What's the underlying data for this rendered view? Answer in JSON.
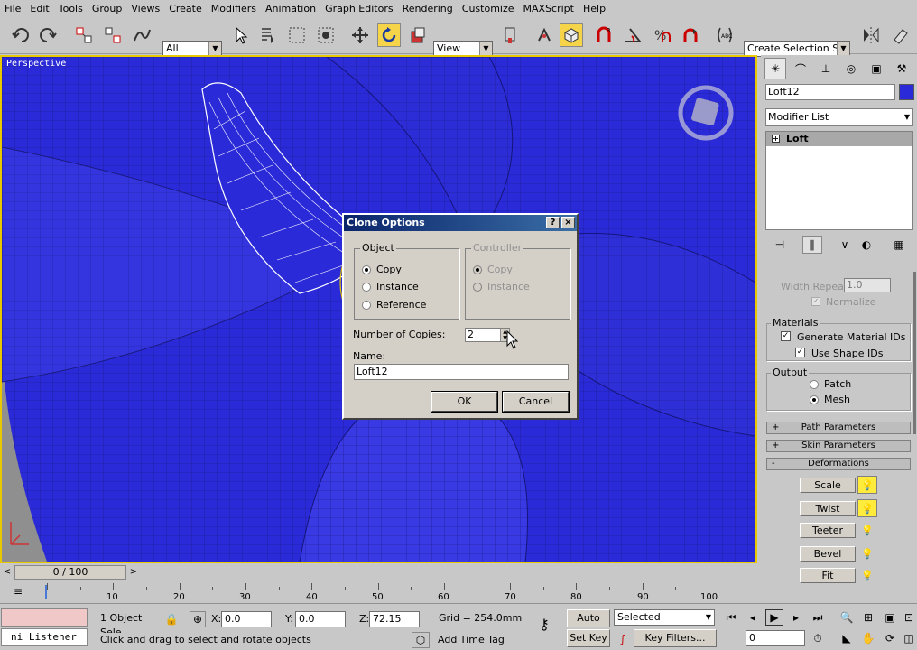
{
  "menu": [
    "File",
    "Edit",
    "Tools",
    "Group",
    "Views",
    "Create",
    "Modifiers",
    "Animation",
    "Graph Editors",
    "Rendering",
    "Customize",
    "MAXScript",
    "Help"
  ],
  "toolbar": {
    "selection_filter": "All",
    "ref_coord": "View",
    "named_selection": "Create Selection Set"
  },
  "viewport": {
    "label": "Perspective"
  },
  "dialog": {
    "title": "Clone Options",
    "help": "?",
    "close": "×",
    "object_group": "Object",
    "object_options": [
      "Copy",
      "Instance",
      "Reference"
    ],
    "object_selected": "Copy",
    "controller_group": "Controller",
    "controller_options": [
      "Copy",
      "Instance"
    ],
    "copies_label": "Number of Copies:",
    "copies_value": "2",
    "name_label": "Name:",
    "name_value": "Loft12",
    "ok": "OK",
    "cancel": "Cancel"
  },
  "command_panel": {
    "object_name": "Loft12",
    "object_color": "#2a2ad8",
    "modifier_list": "Modifier List",
    "stack_item": "Loft",
    "width_repeat_label": "Width Repeat:",
    "width_repeat_value": "1.0",
    "normalize": "Normalize",
    "materials_group": "Materials",
    "gen_mat_ids": "Generate Material IDs",
    "use_shape_ids": "Use Shape IDs",
    "output_group": "Output",
    "output_options": [
      "Patch",
      "Mesh"
    ],
    "output_selected": "Mesh",
    "rollouts": [
      {
        "sign": "+",
        "label": "Path Parameters"
      },
      {
        "sign": "+",
        "label": "Skin Parameters"
      },
      {
        "sign": "-",
        "label": "Deformations"
      }
    ],
    "deformations": [
      "Scale",
      "Twist",
      "Teeter",
      "Bevel",
      "Fit"
    ]
  },
  "timeline": {
    "frame": "0 / 100",
    "ticks": [
      "0",
      "10",
      "20",
      "30",
      "40",
      "50",
      "60",
      "70",
      "80",
      "90",
      "100"
    ]
  },
  "status": {
    "listener": "ni Listener",
    "selection": "1 Object Sele",
    "x_label": "X:",
    "x": "0.0",
    "y_label": "Y:",
    "y": "0.0",
    "z_label": "Z:",
    "z": "72.15",
    "grid": "Grid = 254.0mm",
    "prompt": "Click and drag to select and rotate objects",
    "add_time_tag": "Add Time Tag",
    "auto_key": "Auto Key",
    "set_key": "Set Key",
    "selected": "Selected",
    "key_filters": "Key Filters...",
    "current_frame": "0"
  }
}
